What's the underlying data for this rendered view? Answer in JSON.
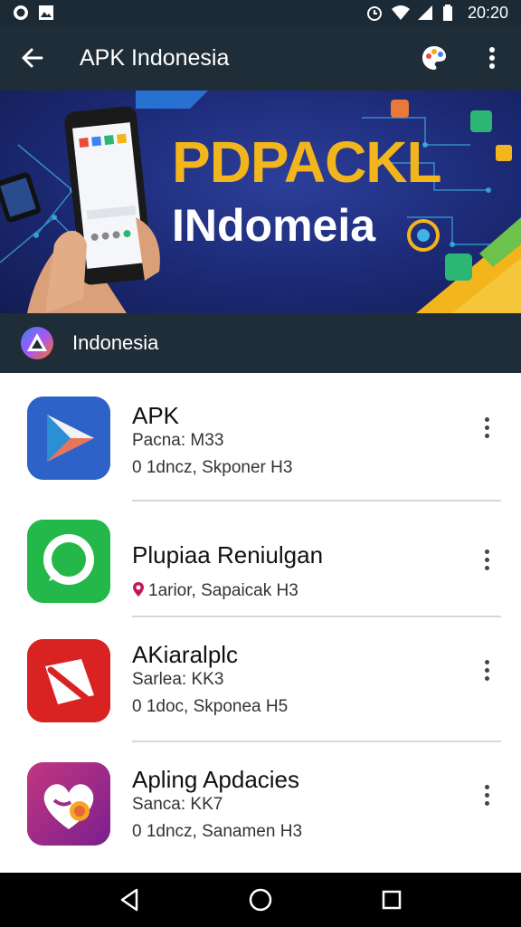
{
  "status_bar": {
    "time": "20:20",
    "icons": [
      "whatsapp-icon",
      "image-icon",
      "alarm-icon",
      "wifi-icon",
      "signal-icon",
      "battery-icon"
    ]
  },
  "app_bar": {
    "title": "APK Indonesia",
    "actions": [
      "back-arrow-icon",
      "palette-icon",
      "more-vert-icon"
    ]
  },
  "banner": {
    "title": "PDPACKL",
    "subtitle": "INdomeia"
  },
  "section": {
    "title": "Indonesia"
  },
  "apps": [
    {
      "name": "APK",
      "line1": "Pacna: M33",
      "line2": "0 1dncz, Skponer H3",
      "icon": "play-store-icon",
      "color": "#2d63c8"
    },
    {
      "name": "Plupiaa Reniulgan",
      "line1": "",
      "line2": "1arior, Sapaicak H3",
      "icon": "whatsapp-icon",
      "color": "#24b84a"
    },
    {
      "name": "AKiaralplc",
      "line1": "Sarlea: KK3",
      "line2": "0 1doc, Skponea H5",
      "icon": "red-app-icon",
      "color": "#d92323"
    },
    {
      "name": "Apling Apdacies",
      "line1": "Sanca: KK7",
      "line2": "0 1dncz, Sanamen H3",
      "icon": "heart-app-icon",
      "color": "#a22a8a"
    }
  ],
  "nav": {
    "buttons": [
      "back-triangle-icon",
      "home-circle-icon",
      "recents-square-icon"
    ]
  }
}
